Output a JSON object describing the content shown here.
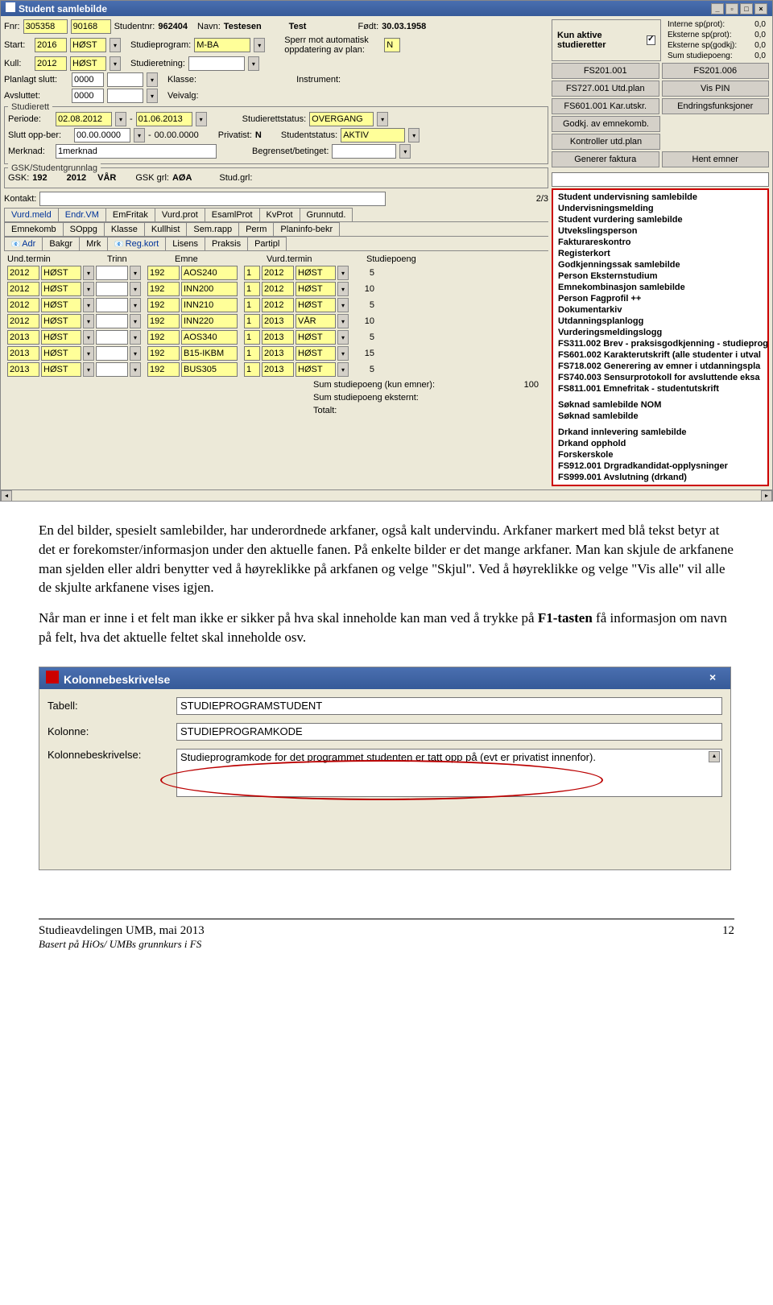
{
  "window": {
    "title": "Student samlebilde"
  },
  "student": {
    "fnr_lbl": "Fnr:",
    "fnr1": "305358",
    "fnr2": "90168",
    "studnr_lbl": "Studentnr:",
    "studnr": "962404",
    "navn_lbl": "Navn:",
    "etternavn": "Testesen",
    "fornavn": "Test",
    "fodt_lbl": "Født:",
    "fodt": "30.03.1958",
    "start_lbl": "Start:",
    "start_year": "2016",
    "start_sem": "HØST",
    "studieprog_lbl": "Studieprogram:",
    "studieprog": "M-BA",
    "sperr_lbl": "Sperr mot automatisk oppdatering av plan:",
    "sperr_val": "N",
    "kull_lbl": "Kull:",
    "kull_year": "2012",
    "kull_sem": "HØST",
    "studieretning_lbl": "Studieretning:",
    "planlagt_lbl": "Planlagt slutt:",
    "planlagt": "0000",
    "klasse_lbl": "Klasse:",
    "instrument_lbl": "Instrument:",
    "avsluttet_lbl": "Avsluttet:",
    "avsluttet": "0000",
    "veivalg_lbl": "Veivalg:"
  },
  "studierett": {
    "legend": "Studierett",
    "periode_lbl": "Periode:",
    "periode_fra": "02.08.2012",
    "periode_til": "01.06.2013",
    "status_lbl": "Studierettstatus:",
    "status": "OVERGANG",
    "sluttopp_lbl": "Slutt opp-ber:",
    "sluttopp_fra": "00.00.0000",
    "sluttopp_til": "00.00.0000",
    "privatist_lbl": "Privatist:",
    "privatist": "N",
    "studentstatus_lbl": "Studentstatus:",
    "studentstatus": "AKTIV",
    "merknad_lbl": "Merknad:",
    "merknad": "1merknad",
    "begrenset_lbl": "Begrenset/betinget:"
  },
  "gsk": {
    "legend": "GSK/Studentgrunnlag",
    "gsk_lbl": "GSK:",
    "gsk_val": "192",
    "gsk_year": "2012",
    "gsk_sem": "VÅR",
    "gskgrl_lbl": "GSK grl:",
    "gskgrl": "AØA",
    "studgrl_lbl": "Stud.grl:",
    "kontakt_lbl": "Kontakt:",
    "counter": "2/3"
  },
  "right": {
    "kun_aktive": "Kun aktive studieretter",
    "sp1_lbl": "Interne sp(prot):",
    "sp1": "0,0",
    "sp2_lbl": "Eksterne sp(prot):",
    "sp2": "0,0",
    "sp3_lbl": "Eksterne sp(godkj):",
    "sp3": "0,0",
    "sp4_lbl": "Sum studiepoeng:",
    "sp4": "0,0",
    "btn_fs201_001": "FS201.001",
    "btn_fs201_006": "FS201.006",
    "btn_utdplan": "FS727.001 Utd.plan",
    "btn_vispin": "Vis PIN",
    "btn_karutskr": "FS601.001 Kar.utskr.",
    "btn_endr": "Endringsfunksjoner",
    "btn_godkj": "Godkj. av emnekomb.",
    "btn_kontroller": "Kontroller utd.plan",
    "btn_generer": "Generer faktura",
    "btn_hent": "Hent emner"
  },
  "tabs": {
    "r1": [
      "Vurd.meld",
      "Endr.VM",
      "EmFritak",
      "Vurd.prot",
      "EsamlProt",
      "KvProt",
      "Grunnutd."
    ],
    "r2": [
      "Emnekomb",
      "SOppg",
      "Klasse",
      "Kullhist",
      "Sem.rapp",
      "Perm",
      "Planinfo-bekr"
    ],
    "r3": [
      "Adr",
      "Bakgr",
      "Mrk",
      "Reg.kort",
      "Lisens",
      "Praksis",
      "Partipl"
    ]
  },
  "grid_headers": {
    "und": "Und.termin",
    "trinn": "Trinn",
    "emne": "Emne",
    "vurd": "Vurd.termin",
    "sp": "Studiepoeng"
  },
  "grid_rows": [
    {
      "y": "2012",
      "s": "HØST",
      "t": "192",
      "e": "AOS240",
      "n": "1",
      "vy": "2012",
      "vs": "HØST",
      "sp": "5"
    },
    {
      "y": "2012",
      "s": "HØST",
      "t": "192",
      "e": "INN200",
      "n": "1",
      "vy": "2012",
      "vs": "HØST",
      "sp": "10"
    },
    {
      "y": "2012",
      "s": "HØST",
      "t": "192",
      "e": "INN210",
      "n": "1",
      "vy": "2012",
      "vs": "HØST",
      "sp": "5"
    },
    {
      "y": "2012",
      "s": "HØST",
      "t": "192",
      "e": "INN220",
      "n": "1",
      "vy": "2013",
      "vs": "VÅR",
      "sp": "10"
    },
    {
      "y": "2013",
      "s": "HØST",
      "t": "192",
      "e": "AOS340",
      "n": "1",
      "vy": "2013",
      "vs": "HØST",
      "sp": "5"
    },
    {
      "y": "2013",
      "s": "HØST",
      "t": "192",
      "e": "B15-IKBM",
      "n": "1",
      "vy": "2013",
      "vs": "HØST",
      "sp": "15"
    },
    {
      "y": "2013",
      "s": "HØST",
      "t": "192",
      "e": "BUS305",
      "n": "1",
      "vy": "2013",
      "vs": "HØST",
      "sp": "5"
    }
  ],
  "sums": {
    "emner_lbl": "Sum studiepoeng (kun emner):",
    "emner": "100",
    "ekstern_lbl": "Sum studiepoeng eksternt:",
    "totalt_lbl": "Totalt:"
  },
  "menu": {
    "items": [
      {
        "t": "Student undervisning samlebilde",
        "b": true
      },
      {
        "t": "Undervisningsmelding",
        "b": true
      },
      {
        "t": "Student vurdering samlebilde",
        "b": true
      },
      {
        "t": "Utvekslingsperson",
        "b": true
      },
      {
        "t": "Fakturareskontro",
        "b": true
      },
      {
        "t": "Registerkort",
        "b": true
      },
      {
        "t": "Godkjenningssak samlebilde",
        "b": true
      },
      {
        "t": "Person Eksternstudium",
        "b": true
      },
      {
        "t": "Emnekombinasjon samlebilde",
        "b": true
      },
      {
        "t": "Person Fagprofil ++",
        "b": true
      },
      {
        "t": "Dokumentarkiv",
        "b": true
      },
      {
        "t": "Utdanningsplanlogg",
        "b": true
      },
      {
        "t": "Vurderingsmeldingslogg",
        "b": true
      },
      {
        "t": "FS311.002 Brev - praksisgodkjenning - studieprog",
        "b": true
      },
      {
        "t": "FS601.002 Karakterutskrift (alle studenter i utval",
        "b": true
      },
      {
        "t": "FS718.002 Generering av emner i utdanningspla",
        "b": true
      },
      {
        "t": "FS740.003 Sensurprotokoll for avsluttende eksa",
        "b": true
      },
      {
        "t": "FS811.001 Emnefritak - studentutskrift",
        "b": true
      },
      {
        "t": "-",
        "b": false
      },
      {
        "t": "Søknad samlebilde NOM",
        "b": true
      },
      {
        "t": "Søknad samlebilde",
        "b": true
      },
      {
        "t": "-",
        "b": false
      },
      {
        "t": "Drkand innlevering samlebilde",
        "b": true
      },
      {
        "t": "Drkand opphold",
        "b": true
      },
      {
        "t": "Forskerskole",
        "b": true
      },
      {
        "t": "FS912.001 Drgradkandidat-opplysninger",
        "b": true
      },
      {
        "t": "FS999.001 Avslutning (drkand)",
        "b": true
      }
    ]
  },
  "paragraphs": {
    "p1": "En del bilder, spesielt samlebilder, har underordnede arkfaner, også kalt undervindu. Arkfaner markert med blå tekst betyr at det er forekomster/informasjon under den aktuelle fanen. På enkelte bilder er det mange arkfaner. Man kan skjule de arkfanene man sjelden eller aldri benytter ved å høyreklikke på arkfanen og velge \"Skjul\". Ved å høyreklikke og velge \"Vis alle\" vil alle de skjulte arkfanene vises igjen.",
    "p2a": "Når man er inne i et felt man ikke er sikker på hva skal inneholde kan man ved å trykke på ",
    "p2b": "F1-tasten",
    "p2c": " få informasjon om navn på felt, hva det aktuelle feltet skal inneholde osv."
  },
  "dialog": {
    "title": "Kolonnebeskrivelse",
    "tabell_lbl": "Tabell:",
    "tabell": "STUDIEPROGRAMSTUDENT",
    "kolonne_lbl": "Kolonne:",
    "kolonne": "STUDIEPROGRAMKODE",
    "beskr_lbl": "Kolonnebeskrivelse:",
    "beskr": "Studieprogramkode for det programmet studenten er tatt opp på (evt er privatist innenfor)."
  },
  "footer": {
    "main": "Studieavdelingen UMB, mai 2013",
    "sub": "Basert på HiOs/ UMBs grunnkurs i FS",
    "page": "12"
  }
}
